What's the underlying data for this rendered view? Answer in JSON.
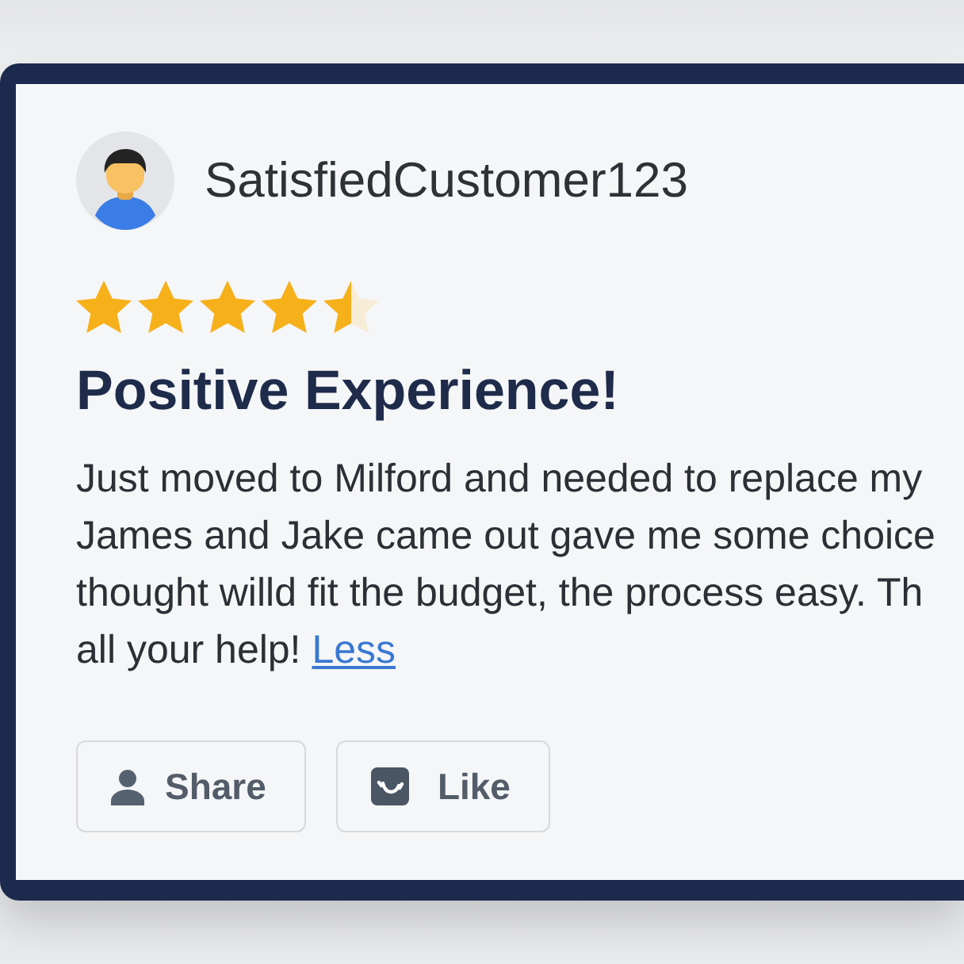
{
  "reviewer": {
    "name": "SatisfiedCustomer123"
  },
  "review": {
    "stars": 4.5,
    "title": "Positive Experience!",
    "body_lines": [
      "Just moved to Milford and needed to replace my",
      "James and Jake came out gave me some choice",
      "thought willd fit the budget, the process easy. Th",
      "all your help!"
    ],
    "less_link": "Less"
  },
  "actions": [
    {
      "label": "Share",
      "kind": "share"
    },
    {
      "label": "Like",
      "kind": "like"
    }
  ]
}
